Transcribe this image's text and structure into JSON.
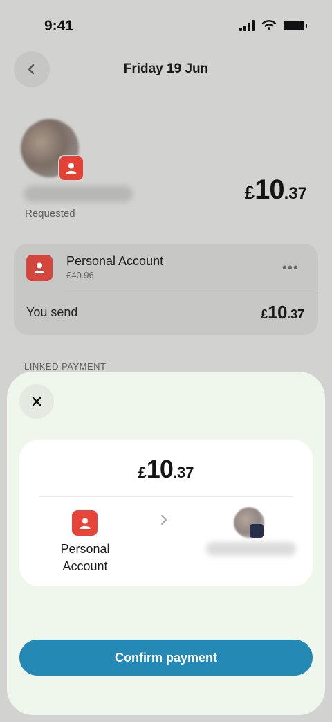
{
  "status_bar": {
    "time": "9:41",
    "icons": [
      "signal-icon",
      "wifi-icon",
      "battery-icon"
    ]
  },
  "header": {
    "title": "Friday 19 Jun",
    "back_icon": "chevron-left-icon"
  },
  "request": {
    "status": "Requested",
    "amount": {
      "currency": "£",
      "whole": "10",
      "decimal": ".37"
    }
  },
  "account_card": {
    "name": "Personal Account",
    "balance": "£40.96",
    "more_icon": "more-horizontal-icon",
    "send_label": "You send",
    "send_amount": {
      "currency": "£",
      "whole": "10",
      "decimal": ".37"
    }
  },
  "linked_section": {
    "label": "LINKED PAYMENT"
  },
  "sheet": {
    "close_icon": "close-icon",
    "amount": {
      "currency": "£",
      "whole": "10",
      "decimal": ".37"
    },
    "from_label": "Personal Account",
    "arrow_icon": "chevron-right-icon",
    "confirm_label": "Confirm payment"
  },
  "colors": {
    "accent": "#2589b6",
    "account_icon": "#e8453a",
    "sheet_background": "#eff6ec"
  }
}
